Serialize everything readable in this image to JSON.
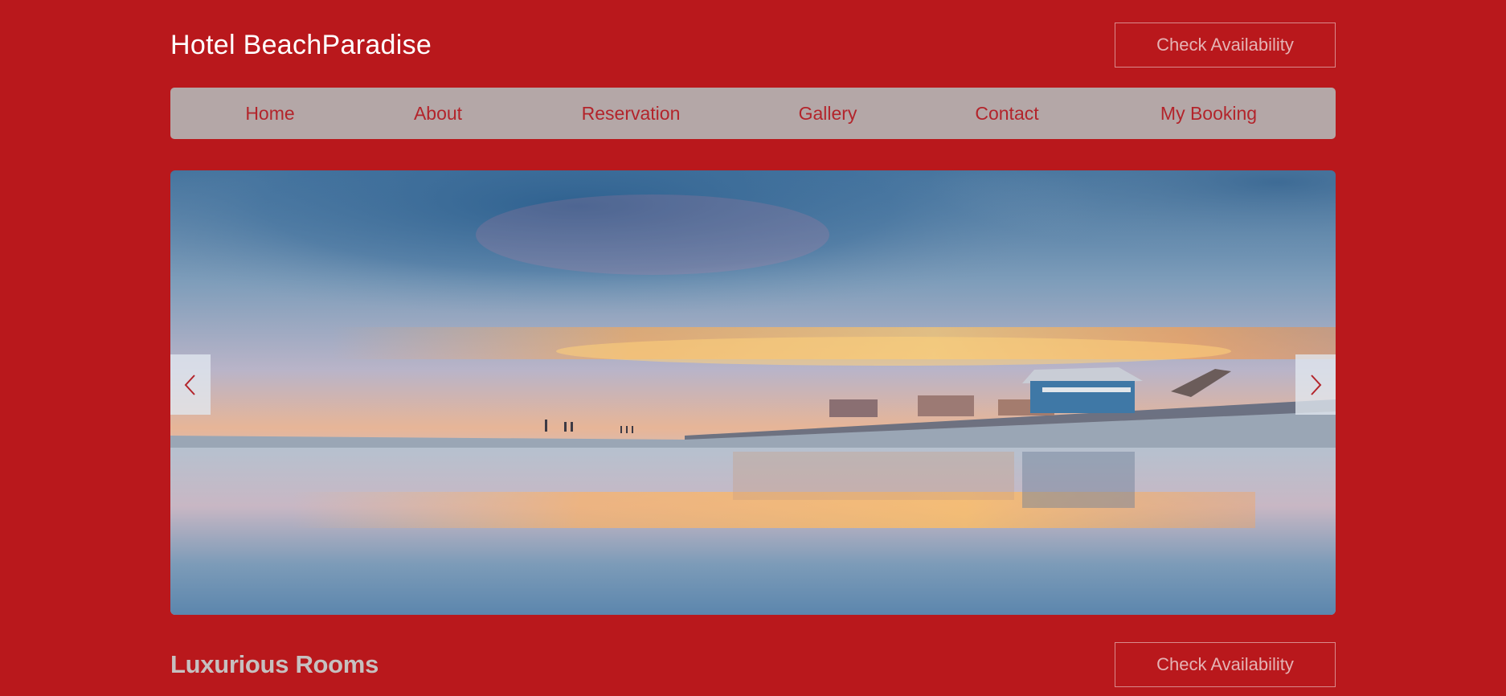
{
  "header": {
    "brand": "Hotel BeachParadise",
    "cta_label": "Check Availability"
  },
  "nav": {
    "items": [
      {
        "label": "Home"
      },
      {
        "label": "About"
      },
      {
        "label": "Reservation"
      },
      {
        "label": "Gallery"
      },
      {
        "label": "Contact"
      },
      {
        "label": "My Booking"
      }
    ]
  },
  "hero": {
    "image": "beach-sunset-photo",
    "prev_icon": "chevron-left-icon",
    "next_icon": "chevron-right-icon"
  },
  "section": {
    "title": "Luxurious Rooms",
    "cta_label": "Check Availability"
  },
  "colors": {
    "background": "#b9181c",
    "nav_background": "#b4a7a7",
    "nav_text": "#b3242b",
    "brand_text": "#ffffff",
    "button_text": "#e4b3b4"
  }
}
